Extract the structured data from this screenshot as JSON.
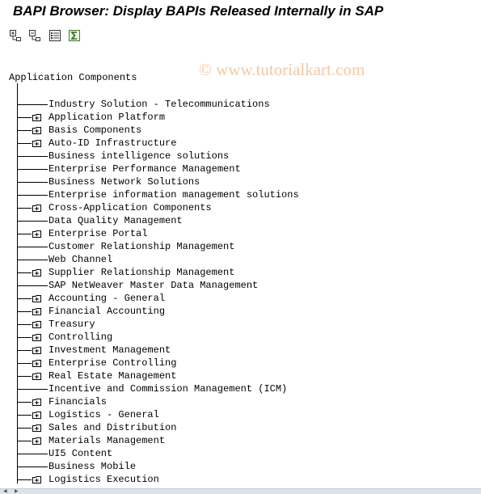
{
  "title": "BAPI Browser: Display BAPIs Released Internally in SAP",
  "watermark": "© www.tutorialkart.com",
  "toolbar": {
    "buttons": [
      {
        "icon": "expand-subtree-icon"
      },
      {
        "icon": "collapse-subtree-icon"
      },
      {
        "icon": "details-list-icon"
      },
      {
        "icon": "sum-icon"
      }
    ]
  },
  "tree": {
    "root_label": "Application Components",
    "nodes": [
      {
        "label": "Industry Solution - Telecommunications",
        "folder": false
      },
      {
        "label": "Application Platform",
        "folder": true
      },
      {
        "label": "Basis Components",
        "folder": true
      },
      {
        "label": "Auto-ID Infrastructure",
        "folder": true
      },
      {
        "label": "Business intelligence solutions",
        "folder": false
      },
      {
        "label": "Enterprise Performance Management",
        "folder": false
      },
      {
        "label": "Business Network Solutions",
        "folder": false
      },
      {
        "label": "Enterprise information management solutions",
        "folder": false
      },
      {
        "label": "Cross-Application Components",
        "folder": true
      },
      {
        "label": "Data Quality Management",
        "folder": false
      },
      {
        "label": "Enterprise Portal",
        "folder": true
      },
      {
        "label": "Customer Relationship Management",
        "folder": false
      },
      {
        "label": "Web Channel",
        "folder": false
      },
      {
        "label": "Supplier Relationship Management",
        "folder": true
      },
      {
        "label": "SAP NetWeaver Master Data Management",
        "folder": false
      },
      {
        "label": "Accounting - General",
        "folder": true
      },
      {
        "label": "Financial Accounting",
        "folder": true
      },
      {
        "label": "Treasury",
        "folder": true
      },
      {
        "label": "Controlling",
        "folder": true
      },
      {
        "label": "Investment Management",
        "folder": true
      },
      {
        "label": "Enterprise Controlling",
        "folder": true
      },
      {
        "label": "Real Estate Management",
        "folder": true
      },
      {
        "label": "Incentive and Commission Management (ICM)",
        "folder": false
      },
      {
        "label": "Financials",
        "folder": true
      },
      {
        "label": "Logistics - General",
        "folder": true
      },
      {
        "label": "Sales and Distribution",
        "folder": true
      },
      {
        "label": "Materials Management",
        "folder": true
      },
      {
        "label": "UI5 Content",
        "folder": false
      },
      {
        "label": "Business Mobile",
        "folder": false
      },
      {
        "label": "Logistics Execution",
        "folder": true
      }
    ]
  }
}
